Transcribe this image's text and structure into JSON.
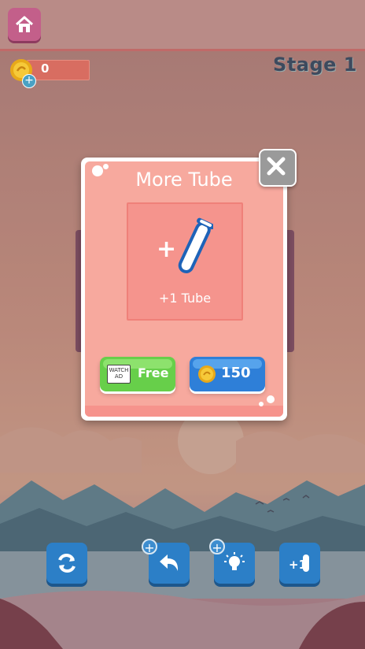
{
  "header": {
    "coins": "0",
    "stage": "Stage 1"
  },
  "modal": {
    "title": "More Tube",
    "item_plus": "+",
    "item_label": "+1 Tube",
    "watch_ad_line1": "WATCH",
    "watch_ad_line2": "AD",
    "free_label": "Free",
    "price": "150"
  },
  "controls": {
    "undo_badge": "+",
    "hint_badge": "+",
    "add_tube_text": "+1"
  },
  "colors": {
    "topbar": "#b98b87",
    "home_button": "#c35f8a",
    "modal_panel": "#f7a99e",
    "free_button": "#67cf4a",
    "buy_button": "#2e7fd8",
    "control_button": "#2c7fc7"
  },
  "icons": [
    "home-icon",
    "coin-icon",
    "close-icon",
    "tube-icon",
    "restart-icon",
    "undo-icon",
    "hint-bulb-icon",
    "add-tube-icon"
  ]
}
